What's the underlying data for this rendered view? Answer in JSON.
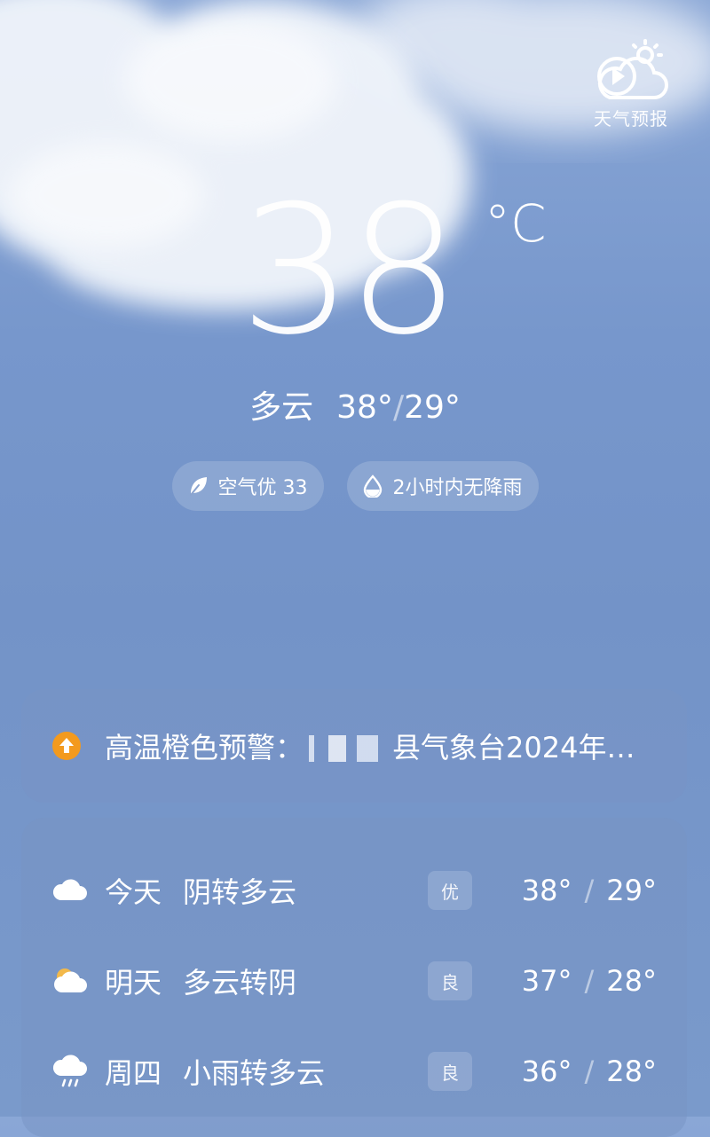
{
  "brand": {
    "label": "天气预报",
    "icon": "weather-forecast-play-icon"
  },
  "current": {
    "temperature": "38",
    "unit": "°C",
    "condition": "多云",
    "high": "38°",
    "low": "29°",
    "separator": "/"
  },
  "chips": [
    {
      "icon": "leaf-icon",
      "label": "空气优 33"
    },
    {
      "icon": "raindrop-icon",
      "label": "2小时内无降雨"
    }
  ],
  "alert": {
    "icon": "warning-arrow-icon",
    "prefix": "高温橙色预警：",
    "suffix": "县气象台2024年…",
    "color": "#f39a1e"
  },
  "forecast": [
    {
      "day": "今天",
      "condition": "阴转多云",
      "aqi": "优",
      "high": "38°",
      "low": "29°",
      "icon": "cloud-icon"
    },
    {
      "day": "明天",
      "condition": "多云转阴",
      "aqi": "良",
      "high": "37°",
      "low": "28°",
      "icon": "partly-cloudy-icon"
    },
    {
      "day": "周四",
      "condition": "小雨转多云",
      "aqi": "良",
      "high": "36°",
      "low": "28°",
      "icon": "light-rain-icon"
    }
  ]
}
